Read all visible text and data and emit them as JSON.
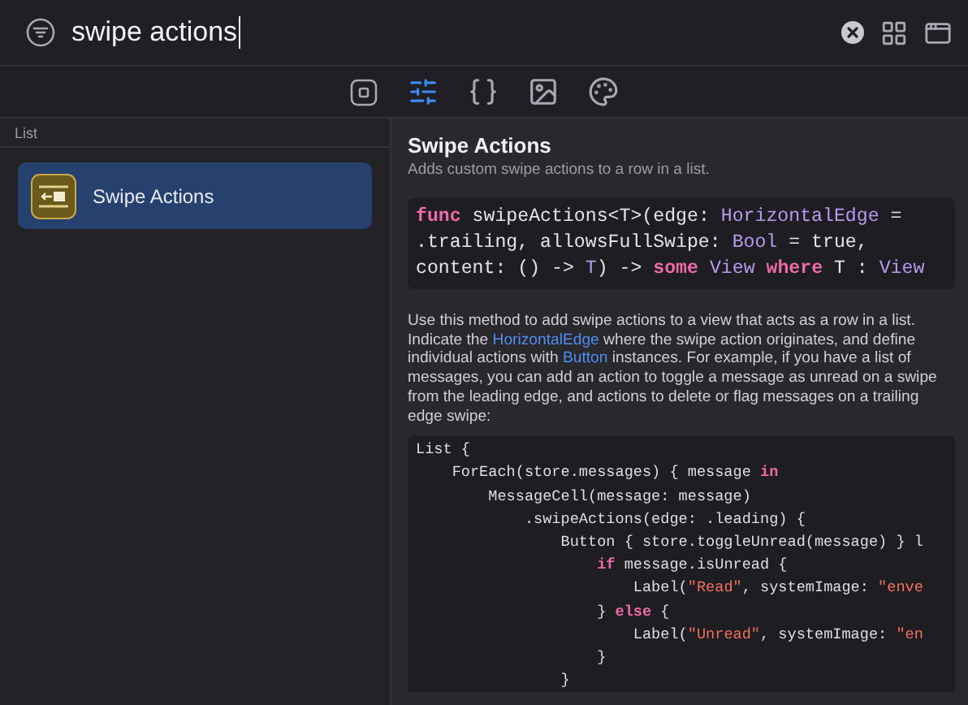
{
  "search": {
    "value": "swipe actions"
  },
  "toolbar": [
    {
      "kind": "views",
      "selected": false
    },
    {
      "kind": "modifiers",
      "selected": true
    },
    {
      "kind": "snippets",
      "selected": false
    },
    {
      "kind": "images",
      "selected": false
    },
    {
      "kind": "colors",
      "selected": false
    }
  ],
  "sidebar": {
    "section": "List",
    "items": [
      {
        "label": "Swipe Actions",
        "selected": true
      }
    ]
  },
  "detail": {
    "title": "Swipe Actions",
    "subtitle": "Adds custom swipe actions to a row in a list.",
    "signature": [
      [
        {
          "kind": "keyword",
          "t": "func"
        },
        {
          "kind": "plain",
          "t": " swipeActions<T>(edge: "
        },
        {
          "kind": "type",
          "t": "HorizontalEdge"
        },
        {
          "kind": "plain",
          "t": " ="
        }
      ],
      [
        {
          "kind": "plain",
          "t": ".trailing, allowsFullSwipe: "
        },
        {
          "kind": "type",
          "t": "Bool"
        },
        {
          "kind": "plain",
          "t": " = true,"
        }
      ],
      [
        {
          "kind": "plain",
          "t": "content: () -> "
        },
        {
          "kind": "type",
          "t": "T"
        },
        {
          "kind": "plain",
          "t": ") -> "
        },
        {
          "kind": "keyword",
          "t": "some"
        },
        {
          "kind": "type",
          "t": " View"
        },
        {
          "kind": "keyword",
          "t": " where"
        },
        {
          "kind": "plain",
          "t": " T : "
        },
        {
          "kind": "type",
          "t": "View"
        }
      ]
    ],
    "description": [
      {
        "link": false,
        "t": "Use this method to add swipe actions to a view that acts as a row in a list. Indicate the "
      },
      {
        "link": true,
        "t": "HorizontalEdge"
      },
      {
        "link": false,
        "t": " where the swipe action originates, and define individual actions with "
      },
      {
        "link": true,
        "t": "Button"
      },
      {
        "link": false,
        "t": " instances. For example, if you have a list of messages, you can add an action to toggle a message as unread on a swipe from the leading edge, and actions to delete or flag messages on a trailing edge swipe:"
      }
    ],
    "example": [
      [
        {
          "kind": "plain",
          "t": "List {"
        }
      ],
      [
        {
          "kind": "plain",
          "t": "    ForEach(store.messages) { message "
        },
        {
          "kind": "keyword",
          "t": "in"
        }
      ],
      [
        {
          "kind": "plain",
          "t": "        MessageCell(message: message)"
        }
      ],
      [
        {
          "kind": "plain",
          "t": "            .swipeActions(edge: .leading) {"
        }
      ],
      [
        {
          "kind": "plain",
          "t": "                Button { store.toggleUnread(message) } l"
        }
      ],
      [
        {
          "kind": "keyword",
          "t": "                    if"
        },
        {
          "kind": "plain",
          "t": " message.isUnread {"
        }
      ],
      [
        {
          "kind": "plain",
          "t": "                        Label("
        },
        {
          "kind": "string",
          "t": "\"Read\""
        },
        {
          "kind": "plain",
          "t": ", systemImage: "
        },
        {
          "kind": "string",
          "t": "\"enve"
        }
      ],
      [
        {
          "kind": "plain",
          "t": "                    } "
        },
        {
          "kind": "keyword",
          "t": "else"
        },
        {
          "kind": "plain",
          "t": " {"
        }
      ],
      [
        {
          "kind": "plain",
          "t": "                        Label("
        },
        {
          "kind": "string",
          "t": "\"Unread\""
        },
        {
          "kind": "plain",
          "t": ", systemImage: "
        },
        {
          "kind": "string",
          "t": "\"en"
        }
      ],
      [
        {
          "kind": "plain",
          "t": "                    }"
        }
      ],
      [
        {
          "kind": "plain",
          "t": "                }"
        }
      ]
    ]
  }
}
